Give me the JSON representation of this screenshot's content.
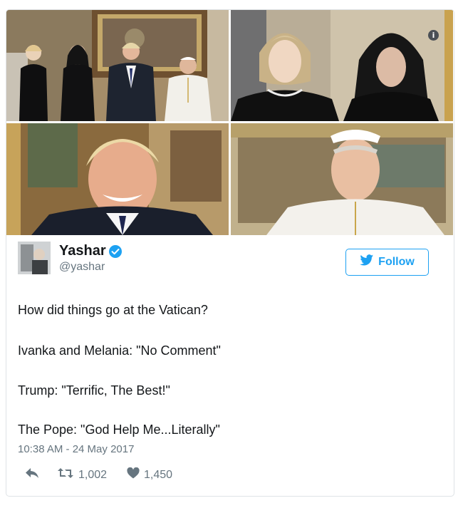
{
  "tweet": {
    "author": {
      "name": "Yashar",
      "handle": "@yashar"
    },
    "follow_label": "Follow",
    "lines": [
      "How did things go at the Vatican?",
      "Ivanka and Melania: \"No Comment\"",
      "Trump: \"Terrific, The Best!\"",
      "The Pope: \"God Help Me...Literally\""
    ],
    "timestamp": "10:38 AM - 24 May 2017",
    "retweets": "1,002",
    "likes": "1,450"
  },
  "media": {
    "photos": [
      "group-photo",
      "two-women-veiled",
      "smiling-man-portrait",
      "pope-portrait"
    ],
    "info_glyph": "i"
  },
  "colors": {
    "accent": "#1da1f2",
    "text": "#14171a",
    "muted": "#66757f",
    "border": "#dfe3e6"
  },
  "icons": [
    "reply-icon",
    "retweet-icon",
    "heart-icon",
    "verified-badge-icon",
    "twitter-bird-icon",
    "info-icon"
  ]
}
